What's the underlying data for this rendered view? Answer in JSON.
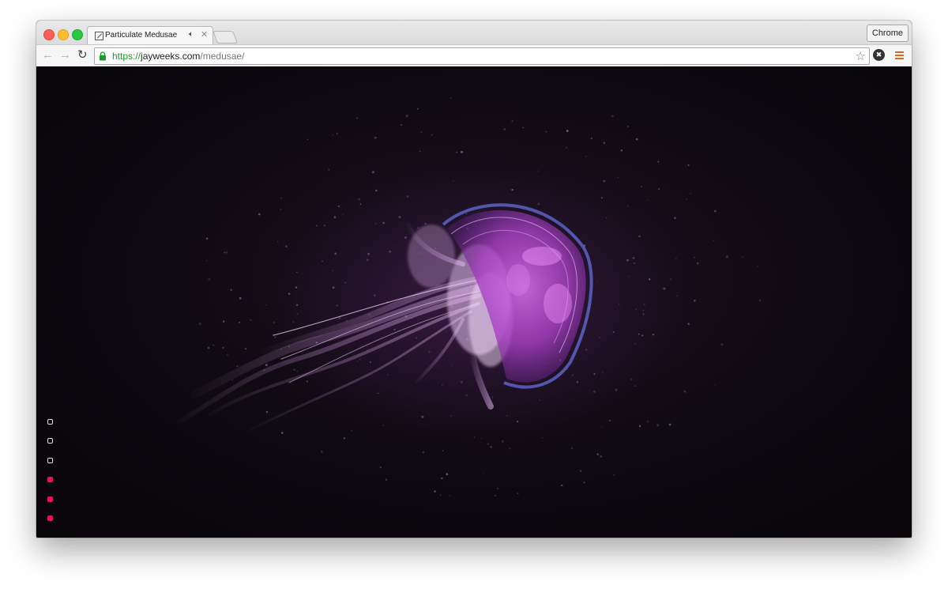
{
  "window": {
    "tab_title": "Particulate Medusae",
    "profile_button": "Chrome"
  },
  "omnibox": {
    "url_scheme": "https://",
    "url_host": "jayweeks.com",
    "url_path": "/medusae/"
  },
  "icons": {
    "back": "back-arrow-icon",
    "forward": "forward-arrow-icon",
    "reload": "reload-icon",
    "lock": "lock-icon",
    "star": "bookmark-star-icon",
    "extension": "extension-icon",
    "menu": "hamburger-menu-icon",
    "audio": "speaker-icon",
    "close": "close-icon"
  },
  "colors": {
    "background": "#0b070c",
    "jellyfish_bell": "#c257d8",
    "jellyfish_rim": "#5b63c4",
    "tentacles": "#e4b4f0",
    "toggle_active": "#e3145a",
    "toggle_inactive": "#e2e2e2"
  },
  "toggles": [
    {
      "active": false
    },
    {
      "active": false
    },
    {
      "active": false
    },
    {
      "active": true
    },
    {
      "active": true
    },
    {
      "active": true
    }
  ]
}
